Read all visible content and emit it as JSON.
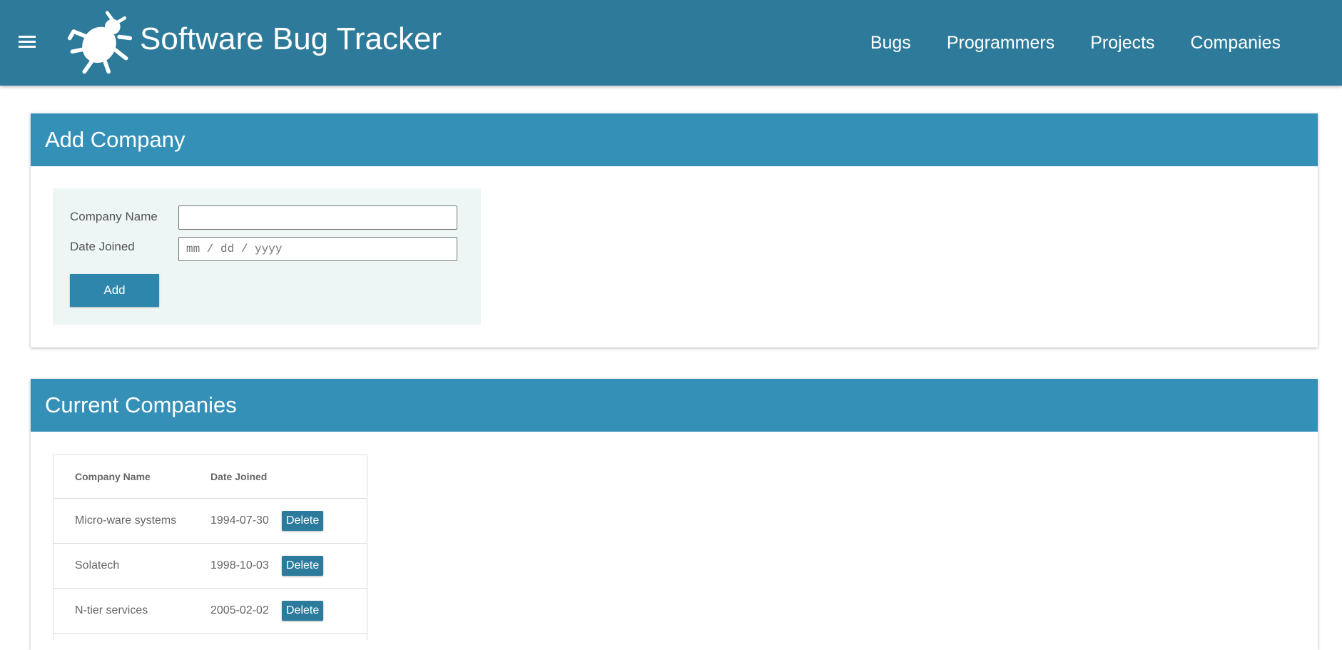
{
  "header": {
    "menu_icon": "hamburger-menu-icon",
    "logo_icon": "bug-icon",
    "title": "Software Bug Tracker",
    "nav": [
      {
        "label": "Bugs"
      },
      {
        "label": "Programmers"
      },
      {
        "label": "Projects"
      },
      {
        "label": "Companies"
      }
    ]
  },
  "add_company": {
    "title": "Add Company",
    "name_label": "Company Name",
    "name_value": "",
    "date_label": "Date Joined",
    "date_placeholder": "mm / dd / yyyy",
    "add_label": "Add"
  },
  "current_companies": {
    "title": "Current Companies",
    "columns": [
      "Company Name",
      "Date Joined"
    ],
    "rows": [
      {
        "name": "Micro-ware systems",
        "date": "1994-07-30",
        "action": "Delete"
      },
      {
        "name": "Solatech",
        "date": "1998-10-03",
        "action": "Delete"
      },
      {
        "name": "N-tier services",
        "date": "2005-02-02",
        "action": "Delete"
      }
    ]
  },
  "colors": {
    "header_bg": "#2e7a9a",
    "card_header_bg": "#3590b8",
    "button_bg": "#2f86ad",
    "form_bg": "#eef6f5"
  }
}
